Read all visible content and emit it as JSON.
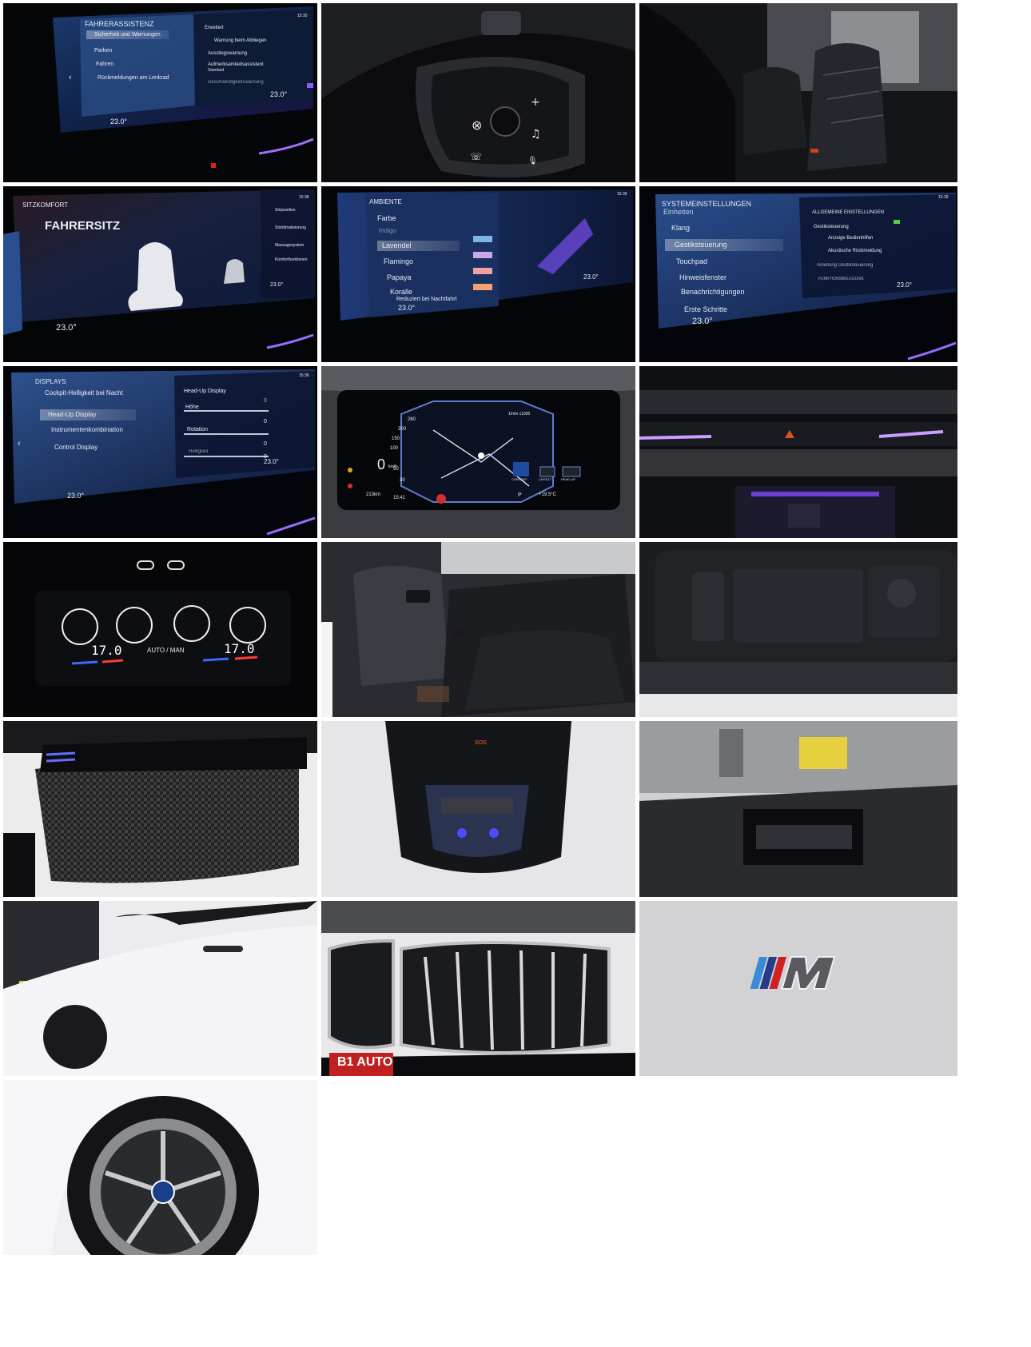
{
  "gallery": {
    "tiles": [
      {
        "id": "driver-assistance-screen",
        "menu_title": "FAHRERASSISTENZ",
        "menu_items": [
          "Sicherheit und Warnungen",
          "Parken",
          "Fahren",
          "Rückmeldungen am Lenkrad"
        ],
        "right_title": "Erweitert",
        "right_items": [
          "Warnung beim Abbiegen",
          "Ausstiegswarnung",
          "Aufmerksamkeitsassistent",
          "Standard",
          "Geschwindigkeitswarnung"
        ],
        "temp_left": "23.0°",
        "temp_right": "23.0°",
        "time": "15:30"
      },
      {
        "id": "steering-wheel-controls"
      },
      {
        "id": "front-seats-interior"
      },
      {
        "id": "seat-comfort-screen",
        "section_title": "SITZKOMFORT",
        "heading": "FAHRERSITZ",
        "side_items": [
          "Sitzposition",
          "Sitzklimatisierung",
          "Massagesystem",
          "Komfortfunktionen"
        ],
        "temp_left": "23.0°",
        "temp_right": "23.0°",
        "time": "15:38"
      },
      {
        "id": "ambient-screen",
        "menu_title": "AMBIENTE",
        "items": [
          "Farbe",
          "Indigo",
          "Lavendel",
          "Flamingo",
          "Papaya",
          "Koralle",
          "Reduziert bei Nachtfahrt"
        ],
        "temp_left": "23.0°",
        "temp_right": "23.0°",
        "time": "15:39"
      },
      {
        "id": "system-settings-screen",
        "menu_title": "SYSTEMEINSTELLUNGEN",
        "items": [
          "Einheiten",
          "Klang",
          "Gestiksteuerung",
          "Touchpad",
          "Hinweisfenster",
          "Benachrichtigungen",
          "Erste Schritte"
        ],
        "right_title": "ALLGEMEINE EINSTELLUNGEN",
        "right_items": [
          "Gestiksteuerung",
          "Anzeige Bedienhilfen",
          "Akustische Rückmeldung",
          "Anleitung Gestiksteuerung",
          "FUNKTIONSBELEGUNG"
        ],
        "temp_left": "23.0°",
        "temp_right": "23.0°",
        "time": "15:39"
      },
      {
        "id": "displays-screen",
        "menu_title": "DISPLAYS",
        "items": [
          "Cockpit-Helligkeit bei Nacht",
          "Head-Up Display",
          "Instrumentenkombination",
          "Control Display"
        ],
        "right_title": "Head-Up Display",
        "right_items": [
          "Höhe",
          "Rotation",
          "Helligkeit"
        ],
        "values": [
          "0",
          "0",
          "0",
          "0"
        ],
        "temp_left": "23.0°",
        "temp_right": "23.0°",
        "time": "15:38"
      },
      {
        "id": "instrument-cluster",
        "speed": "0",
        "speed_unit": "km/h",
        "ticks": [
          "260",
          "200",
          "150",
          "100",
          "50",
          "30"
        ],
        "rpm_label": "1/min x1000",
        "range": "213km",
        "clock": "15:41",
        "outside_temp": "+19.5°C",
        "gear": "P",
        "buttons": [
          "CONTENT",
          "LAYOUT",
          "HEAD-UP"
        ]
      },
      {
        "id": "dashboard-ambient-light"
      },
      {
        "id": "rear-climate-panel",
        "temp_left": "17.0",
        "temp_right": "17.0",
        "mode": "AUTO / MAN"
      },
      {
        "id": "rear-seats"
      },
      {
        "id": "window-controls"
      },
      {
        "id": "carbon-trim-headliner"
      },
      {
        "id": "overhead-console",
        "sos": "SOS"
      },
      {
        "id": "head-up-display-unit"
      },
      {
        "id": "car-side-door"
      },
      {
        "id": "kidney-grille",
        "plate": "B1 AUTO"
      },
      {
        "id": "m-badge"
      },
      {
        "id": "wheel-rim"
      }
    ]
  }
}
